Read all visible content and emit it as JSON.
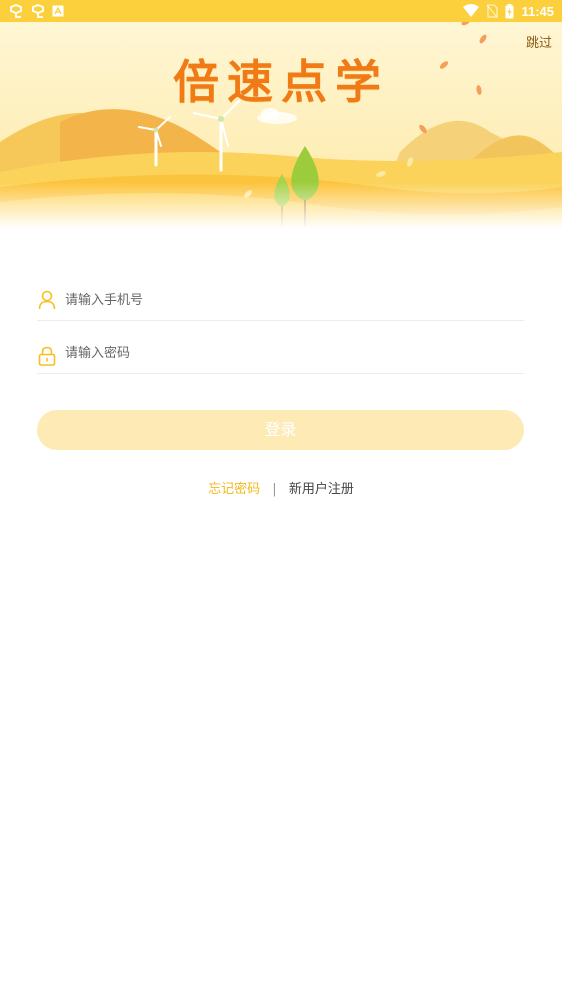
{
  "status_bar": {
    "time": "11:45",
    "left_icons": [
      "app-icon",
      "app-icon",
      "a-icon"
    ],
    "right_icons": [
      "wifi-icon",
      "no-sim-icon",
      "battery-charging-icon"
    ]
  },
  "banner": {
    "title": "倍速点学",
    "skip_label": "跳过"
  },
  "form": {
    "phone_placeholder": "请输入手机号",
    "password_placeholder": "请输入密码",
    "login_label": "登录"
  },
  "links": {
    "forgot_password": "忘记密码",
    "separator": "|",
    "register": "新用户注册"
  },
  "colors": {
    "accent": "#fccf3c",
    "title": "#f07a16",
    "login_button_disabled": "#fdeab5",
    "forgot_link": "#f5b81c"
  }
}
